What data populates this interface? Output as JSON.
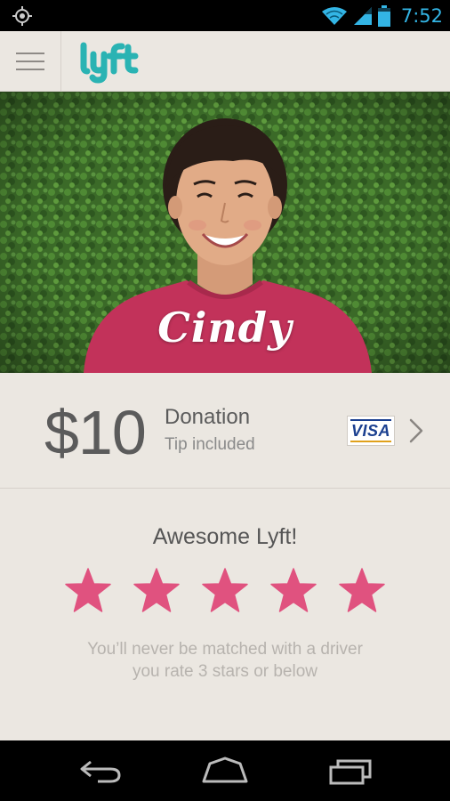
{
  "status_bar": {
    "time": "7:52",
    "left_icon": "location-crosshair-icon",
    "icons": [
      "wifi-icon",
      "signal-icon",
      "battery-icon"
    ],
    "accent_color": "#33b5e5"
  },
  "app_bar": {
    "menu_icon": "hamburger-menu-icon",
    "logo_text": "lyft",
    "logo_color": "#2ab3b3"
  },
  "driver": {
    "name": "Cindy"
  },
  "payment": {
    "amount": "$10",
    "label": "Donation",
    "sublabel": "Tip included",
    "card_brand": "VISA"
  },
  "rating": {
    "title": "Awesome Lyft!",
    "stars": 5,
    "max_stars": 5,
    "star_color": "#e0527f",
    "note_line1": "You’ll never be matched with a driver",
    "note_line2": "you rate 3 stars or below"
  },
  "nav_bar": {
    "buttons": [
      "back-icon",
      "home-icon",
      "recent-apps-icon"
    ]
  }
}
